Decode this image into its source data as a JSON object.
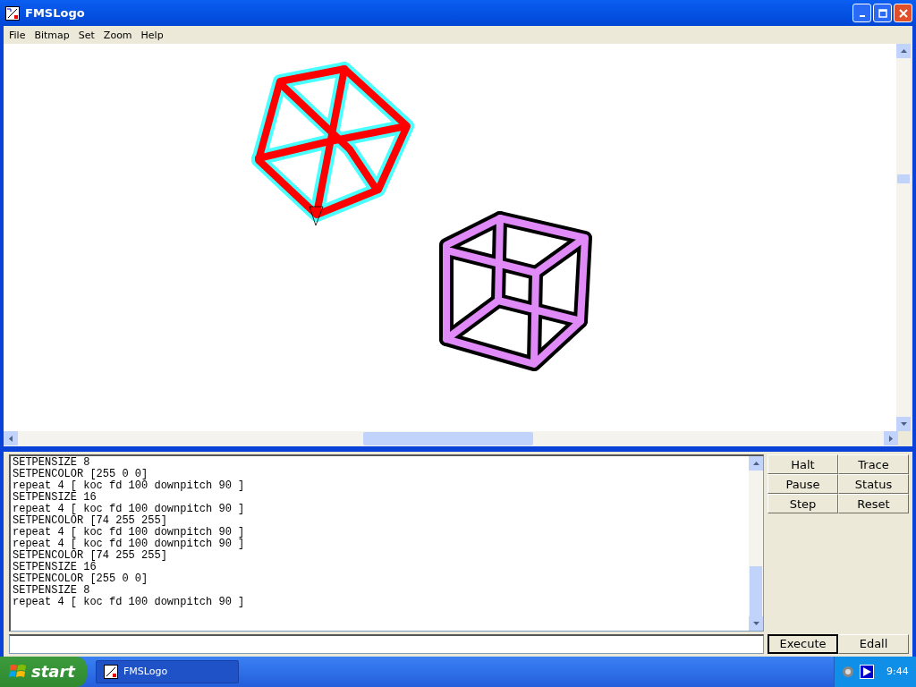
{
  "window": {
    "title": "FMSLogo"
  },
  "menu": [
    "File",
    "Bitmap",
    "Set",
    "Zoom",
    "Help"
  ],
  "console": {
    "lines": [
      "SETPENSIZE 8",
      "SETPENCOLOR [255 0 0]",
      "repeat 4 [ koc fd 100 downpitch 90 ]",
      "SETPENSIZE 16",
      "repeat 4 [ koc fd 100 downpitch 90 ]",
      "SETPENCOLOR [74 255 255]",
      "repeat 4 [ koc fd 100 downpitch 90 ]",
      "repeat 4 [ koc fd 100 downpitch 90 ]",
      "SETPENCOLOR [74 255 255]",
      "SETPENSIZE 16",
      "SETPENCOLOR [255 0 0]",
      "SETPENSIZE 8",
      "repeat 4 [ koc fd 100 downpitch 90 ]"
    ]
  },
  "control_buttons": [
    "Halt",
    "Trace",
    "Pause",
    "Status",
    "Step",
    "Reset"
  ],
  "command_buttons": [
    "Execute",
    "Edall"
  ],
  "taskbar": {
    "start": "start",
    "task": "FMSLogo",
    "clock": "9:44"
  }
}
